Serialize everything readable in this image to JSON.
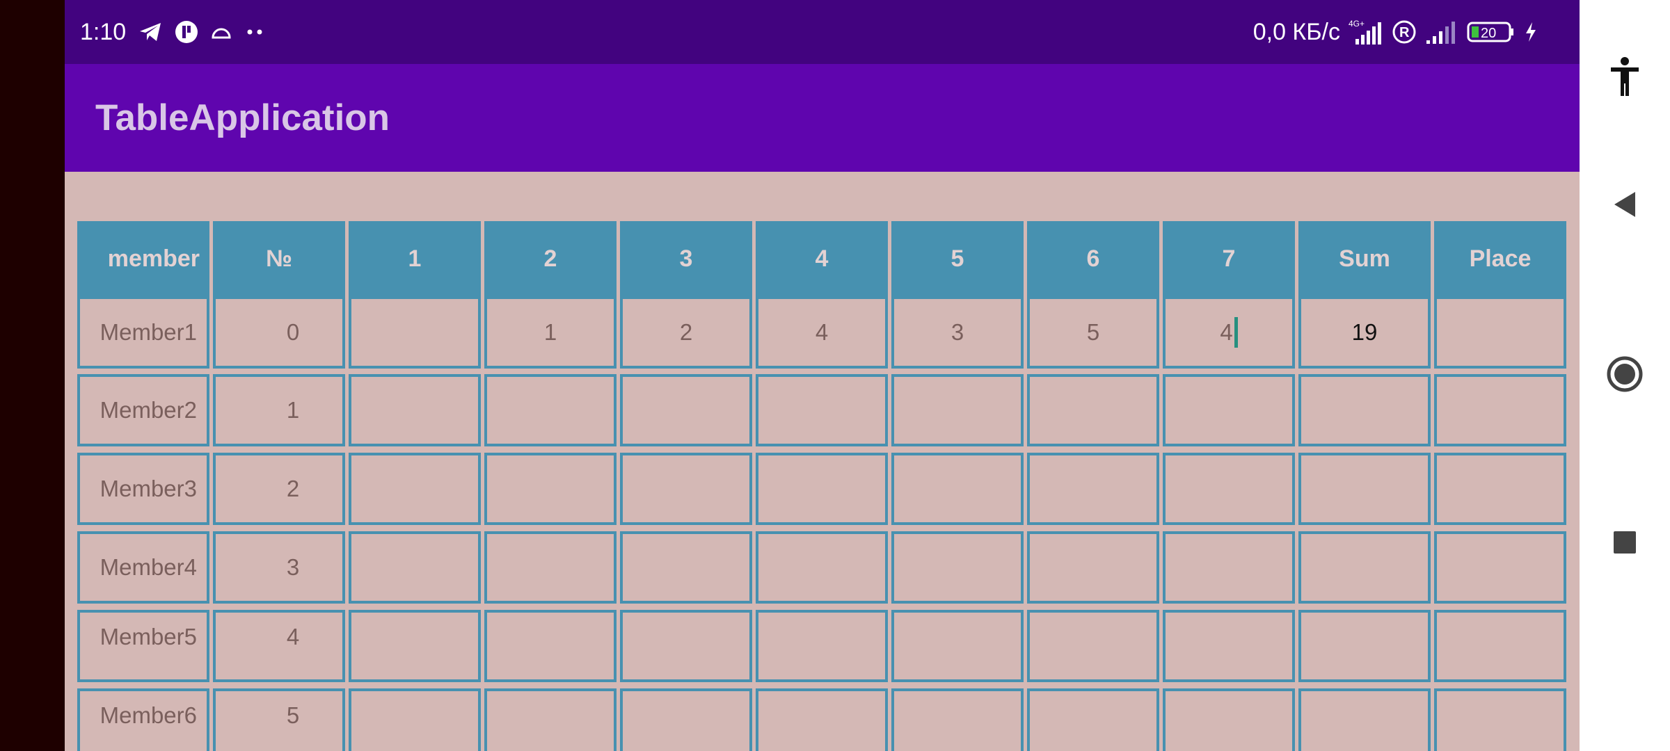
{
  "status_bar": {
    "time": "1:10",
    "net_speed": "0,0 КБ/с",
    "network_label": "4G+",
    "battery_level": "20"
  },
  "app_bar": {
    "title": "TableApplication"
  },
  "table": {
    "columns": [
      "member",
      "№",
      "1",
      "2",
      "3",
      "4",
      "5",
      "6",
      "7",
      "Sum",
      "Place"
    ],
    "rows": [
      {
        "member": "Member1",
        "no": "0",
        "r1": "",
        "r2": "1",
        "r3": "2",
        "r4": "4",
        "r5": "3",
        "r6": "5",
        "r7": "4",
        "sum": "19",
        "place": ""
      },
      {
        "member": "Member2",
        "no": "1",
        "r1": "",
        "r2": "",
        "r3": "",
        "r4": "",
        "r5": "",
        "r6": "",
        "r7": "",
        "sum": "",
        "place": ""
      },
      {
        "member": "Member3",
        "no": "2",
        "r1": "",
        "r2": "",
        "r3": "",
        "r4": "",
        "r5": "",
        "r6": "",
        "r7": "",
        "sum": "",
        "place": ""
      },
      {
        "member": "Member4",
        "no": "3",
        "r1": "",
        "r2": "",
        "r3": "",
        "r4": "",
        "r5": "",
        "r6": "",
        "r7": "",
        "sum": "",
        "place": ""
      },
      {
        "member": "Member5",
        "no": "4",
        "r1": "",
        "r2": "",
        "r3": "",
        "r4": "",
        "r5": "",
        "r6": "",
        "r7": "",
        "sum": "",
        "place": ""
      },
      {
        "member": "Member6",
        "no": "5",
        "r1": "",
        "r2": "",
        "r3": "",
        "r4": "",
        "r5": "",
        "r6": "",
        "r7": "",
        "sum": "",
        "place": ""
      }
    ]
  },
  "navigation": {
    "icons": [
      "accessibility-icon",
      "back-icon",
      "home-icon",
      "recents-icon"
    ]
  },
  "colors": {
    "status_bar": "#42037f",
    "app_bar": "#5f05ae",
    "header": "#4791b0",
    "cell_bg": "#d4b8b5",
    "cursor": "#26907f"
  }
}
